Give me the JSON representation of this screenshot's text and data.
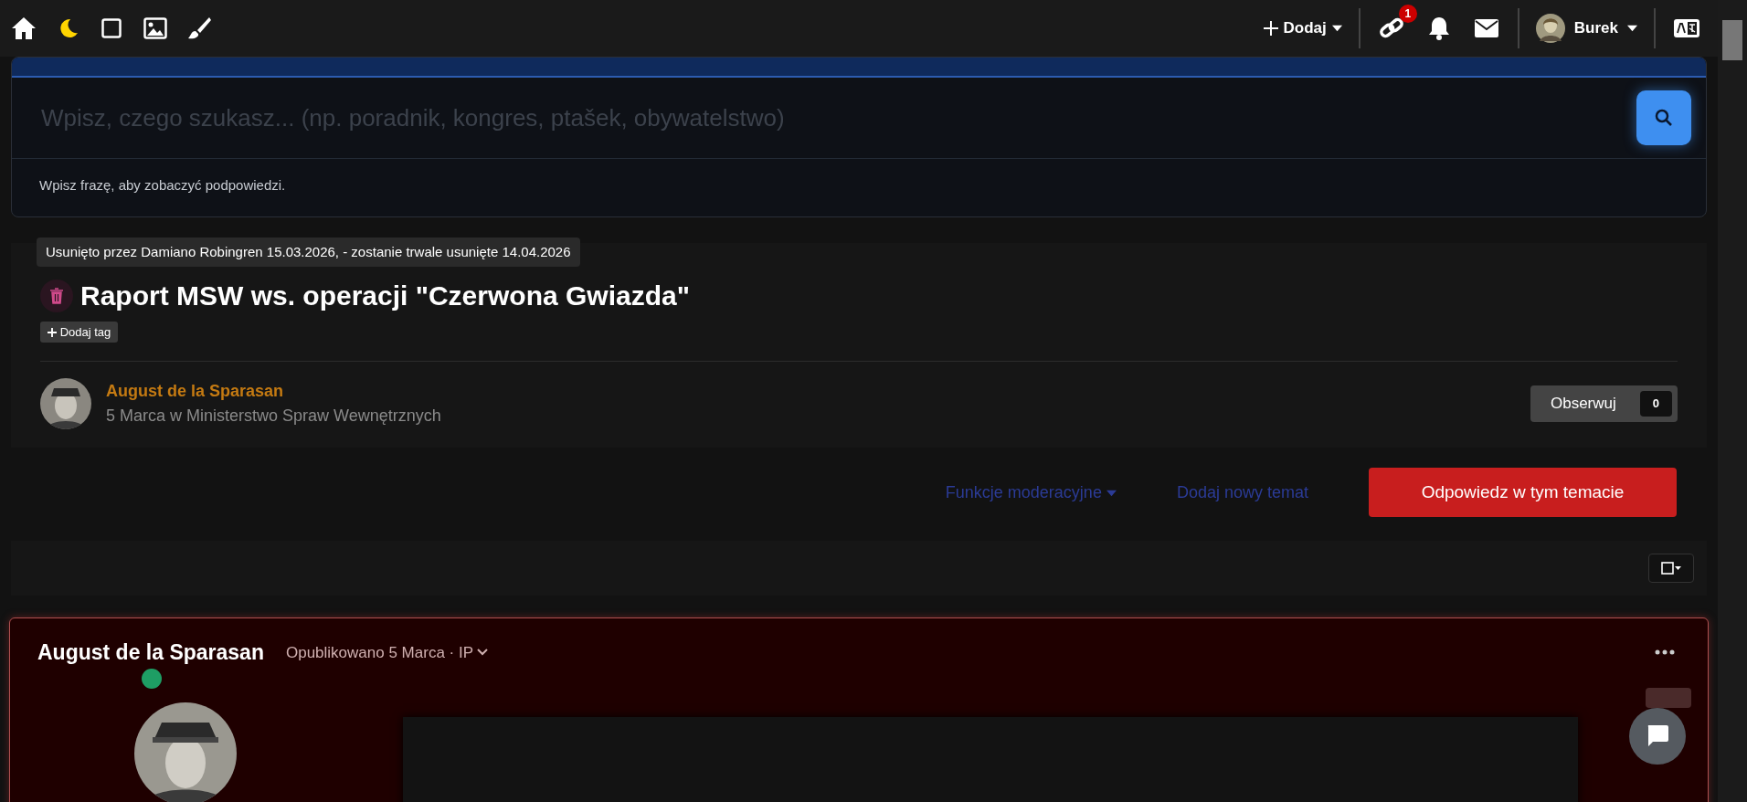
{
  "topbar": {
    "add_label": "Dodaj",
    "link_badge": "1",
    "user_name": "Burek"
  },
  "search": {
    "placeholder": "Wpisz, czego szukasz... (np. poradnik, kongres, ptašek, obywatelstwo)",
    "hint": "Wpisz frazę, aby zobaczyć podpowiedzi."
  },
  "topic": {
    "tooltip": "Usunięto przez Damiano Robingren 15.03.2026, - zostanie trwale usunięte 14.04.2026",
    "deleted": true,
    "title": "Raport MSW ws. operacji \"Czerwona Gwiazda\"",
    "add_tag": "Dodaj tag",
    "author": "August de la Sparasan",
    "meta": "5 Marca w Ministerstwo Spraw Wewnętrznych",
    "follow_label": "Obserwuj",
    "follow_count": "0"
  },
  "actions": [
    {
      "kind": "link",
      "label": "Funkcje moderacyjne",
      "dropdown": true
    },
    {
      "kind": "link",
      "label": "Dodaj nowy temat",
      "dropdown": false
    },
    {
      "kind": "primary",
      "label": "Odpowiedz w tym temacie",
      "dropdown": false
    }
  ],
  "post": {
    "author": "August de la Sparasan",
    "online": true,
    "published": "Opublikowano 5 Marca · IP"
  }
}
